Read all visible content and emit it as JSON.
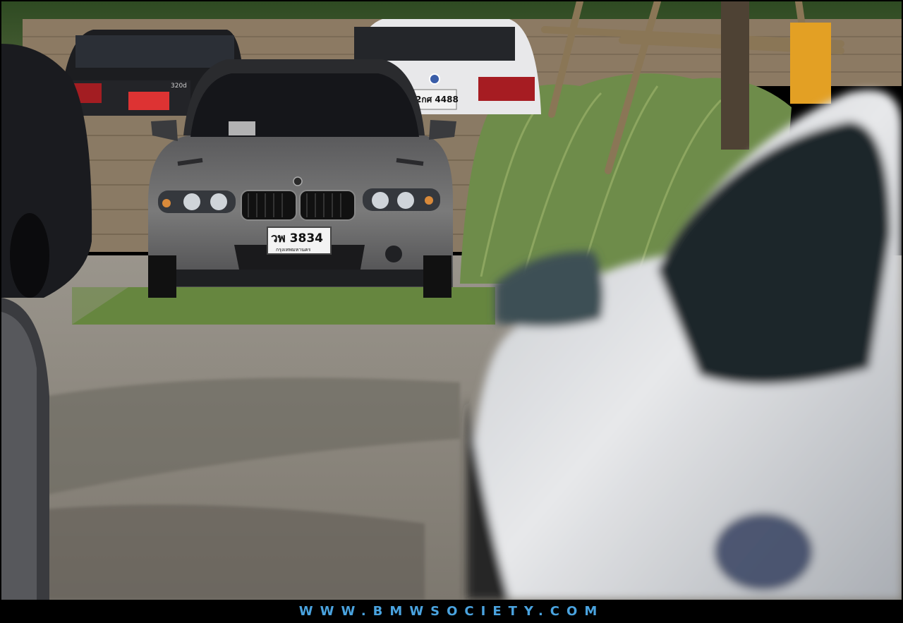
{
  "photo": {
    "alt": "",
    "main_car_plate": "วพ 3834",
    "main_car_plate_province": "กรุงเทพมหานคร",
    "right_bg_car_plate": "2กศ 4488",
    "left_bg_car_badge": "320d"
  },
  "footer": {
    "website": "WWW.BMWSOCIETY.COM",
    "color": "#4aa3df"
  },
  "colors": {
    "frame": "#000000",
    "grass": "#5f7f3a",
    "gravel": "#8f8a80",
    "main_car": "#6e6e6e"
  }
}
